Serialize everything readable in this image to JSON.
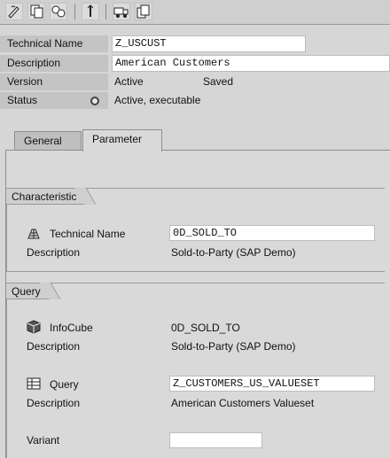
{
  "toolbar": {
    "icons": [
      "edit-icon",
      "copy-icon",
      "activate-icon",
      "check-icon",
      "transport-icon",
      "other-object-icon"
    ]
  },
  "header": {
    "technical_name_label": "Technical Name",
    "technical_name_value": "Z_USCUST",
    "description_label": "Description",
    "description_value": "American Customers",
    "version_label": "Version",
    "version_value": "Active",
    "version_saved": "Saved",
    "status_label": "Status",
    "status_value": "Active, executable"
  },
  "tabs": [
    {
      "label": "General",
      "active": false
    },
    {
      "label": "Parameter",
      "active": true
    }
  ],
  "characteristic": {
    "title": "Characteristic",
    "technical_name_label": "Technical Name",
    "technical_name_value": "0D_SOLD_TO",
    "description_label": "Description",
    "description_value": "Sold-to-Party (SAP Demo)"
  },
  "query": {
    "title": "Query",
    "infocube_label": "InfoCube",
    "infocube_value": "0D_SOLD_TO",
    "infocube_desc_label": "Description",
    "infocube_desc_value": "Sold-to-Party (SAP Demo)",
    "query_label": "Query",
    "query_value": "Z_CUSTOMERS_US_VALUESET",
    "query_desc_label": "Description",
    "query_desc_value": "American Customers Valueset",
    "variant_label": "Variant",
    "variant_value": ""
  }
}
